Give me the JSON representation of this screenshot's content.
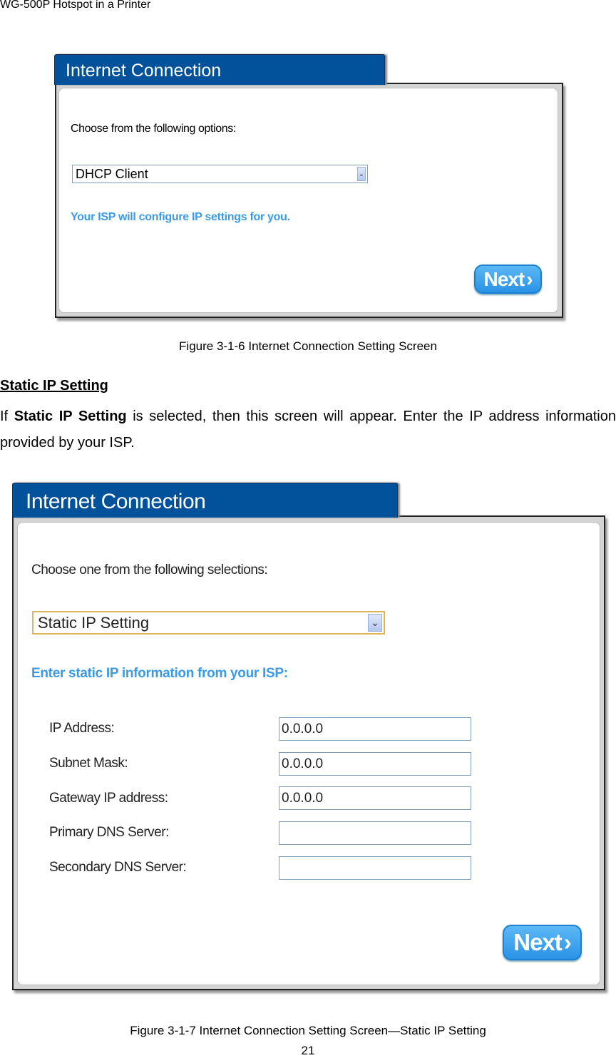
{
  "header": "WG-500P Hotspot in a Printer",
  "figure1": {
    "tab_title": "Internet Connection",
    "prompt": "Choose from the following options:",
    "select_value": "DHCP Client",
    "info": "Your ISP will configure IP settings for you.",
    "next_label": "Next",
    "caption": "Figure 3-1-6 Internet Connection Setting Screen"
  },
  "section": {
    "heading": "Static IP Setting",
    "para_prefix": "If ",
    "para_bold": "Static IP Setting",
    "para_rest": " is selected, then this screen will appear. Enter the IP address information provided by your ISP."
  },
  "figure2": {
    "tab_title": "Internet Connection",
    "prompt": "Choose one from the following selections:",
    "select_value": "Static IP Setting",
    "info": "Enter static IP information from your ISP:",
    "fields": [
      {
        "label": "IP Address:",
        "value": "0.0.0.0"
      },
      {
        "label": "Subnet Mask:",
        "value": "0.0.0.0"
      },
      {
        "label": "Gateway IP address:",
        "value": "0.0.0.0"
      },
      {
        "label": "Primary DNS Server:",
        "value": ""
      },
      {
        "label": "Secondary DNS Server:",
        "value": ""
      }
    ],
    "next_label": "Next",
    "caption": "Figure 3-1-7 Internet Connection Setting Screen—Static IP Setting"
  },
  "page_number": "21",
  "colors": {
    "tab": "#01519b",
    "accent": "#3a9ae6",
    "button": "#2a93e6"
  }
}
